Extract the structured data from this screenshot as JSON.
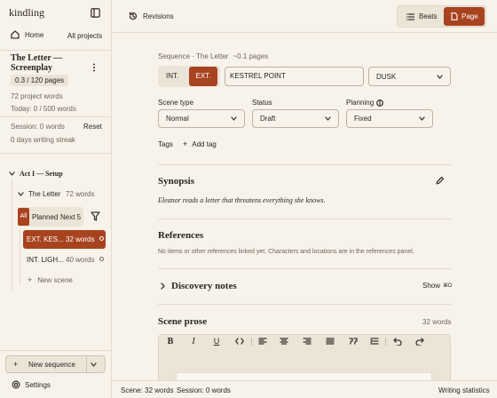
{
  "app": {
    "logo": "kindling"
  },
  "sidebar": {
    "home_label": "Home",
    "all_projects": "All projects",
    "project_title_line1": "The Letter —",
    "project_title_line2": "Screenplay",
    "pages_badge": "0.3 / 120 pages",
    "project_words": "72 project words",
    "today": "Today: 0 / 500 words",
    "session": "Session: 0 words",
    "reset": "Reset",
    "streak": "0 days writing streak",
    "act_label": "Act I — Setup",
    "scene_label": "The Letter",
    "scene_words": "72 words",
    "filter_all": "All",
    "filter_planned": "Planned",
    "filter_next": "Next 5",
    "items": [
      {
        "label": "EXT. KES...",
        "words": "32 words"
      },
      {
        "label": "INT. LIGH...",
        "words": "40 words"
      }
    ],
    "new_scene": "New scene",
    "new_sequence": "New sequence",
    "settings": "Settings"
  },
  "topbar": {
    "revisions": "Revisions",
    "beats": "Beats",
    "page": "Page"
  },
  "editor": {
    "breadcrumb": "Sequence · The Letter",
    "pages_est": "~0.1 pages",
    "int_label": "INT.",
    "ext_label": "EXT.",
    "location": "KESTREL POINT",
    "time": "DUSK",
    "scene_type_label": "Scene type",
    "scene_type_value": "Normal",
    "status_label": "Status",
    "status_value": "Draft",
    "planning_label": "Planning",
    "planning_value": "Fixed",
    "tags_label": "Tags",
    "add_tag": "Add tag",
    "synopsis_heading": "Synopsis",
    "synopsis_text": "Eleanor reads a letter that threatens everything she knows.",
    "references_heading": "References",
    "references_text": "No items or other references linked yet. Characters and locations are in the references panel.",
    "discovery_heading": "Discovery notes",
    "show_label": "Show",
    "prose_heading": "Scene prose",
    "prose_words": "32 words"
  },
  "statusbar": {
    "scene": "Scene: 32 words",
    "session": "Session: 0 words",
    "stats": "Writing statistics"
  },
  "colors": {
    "accent": "#a8431f",
    "background": "#f7f2ea",
    "border": "#e4dccd"
  }
}
